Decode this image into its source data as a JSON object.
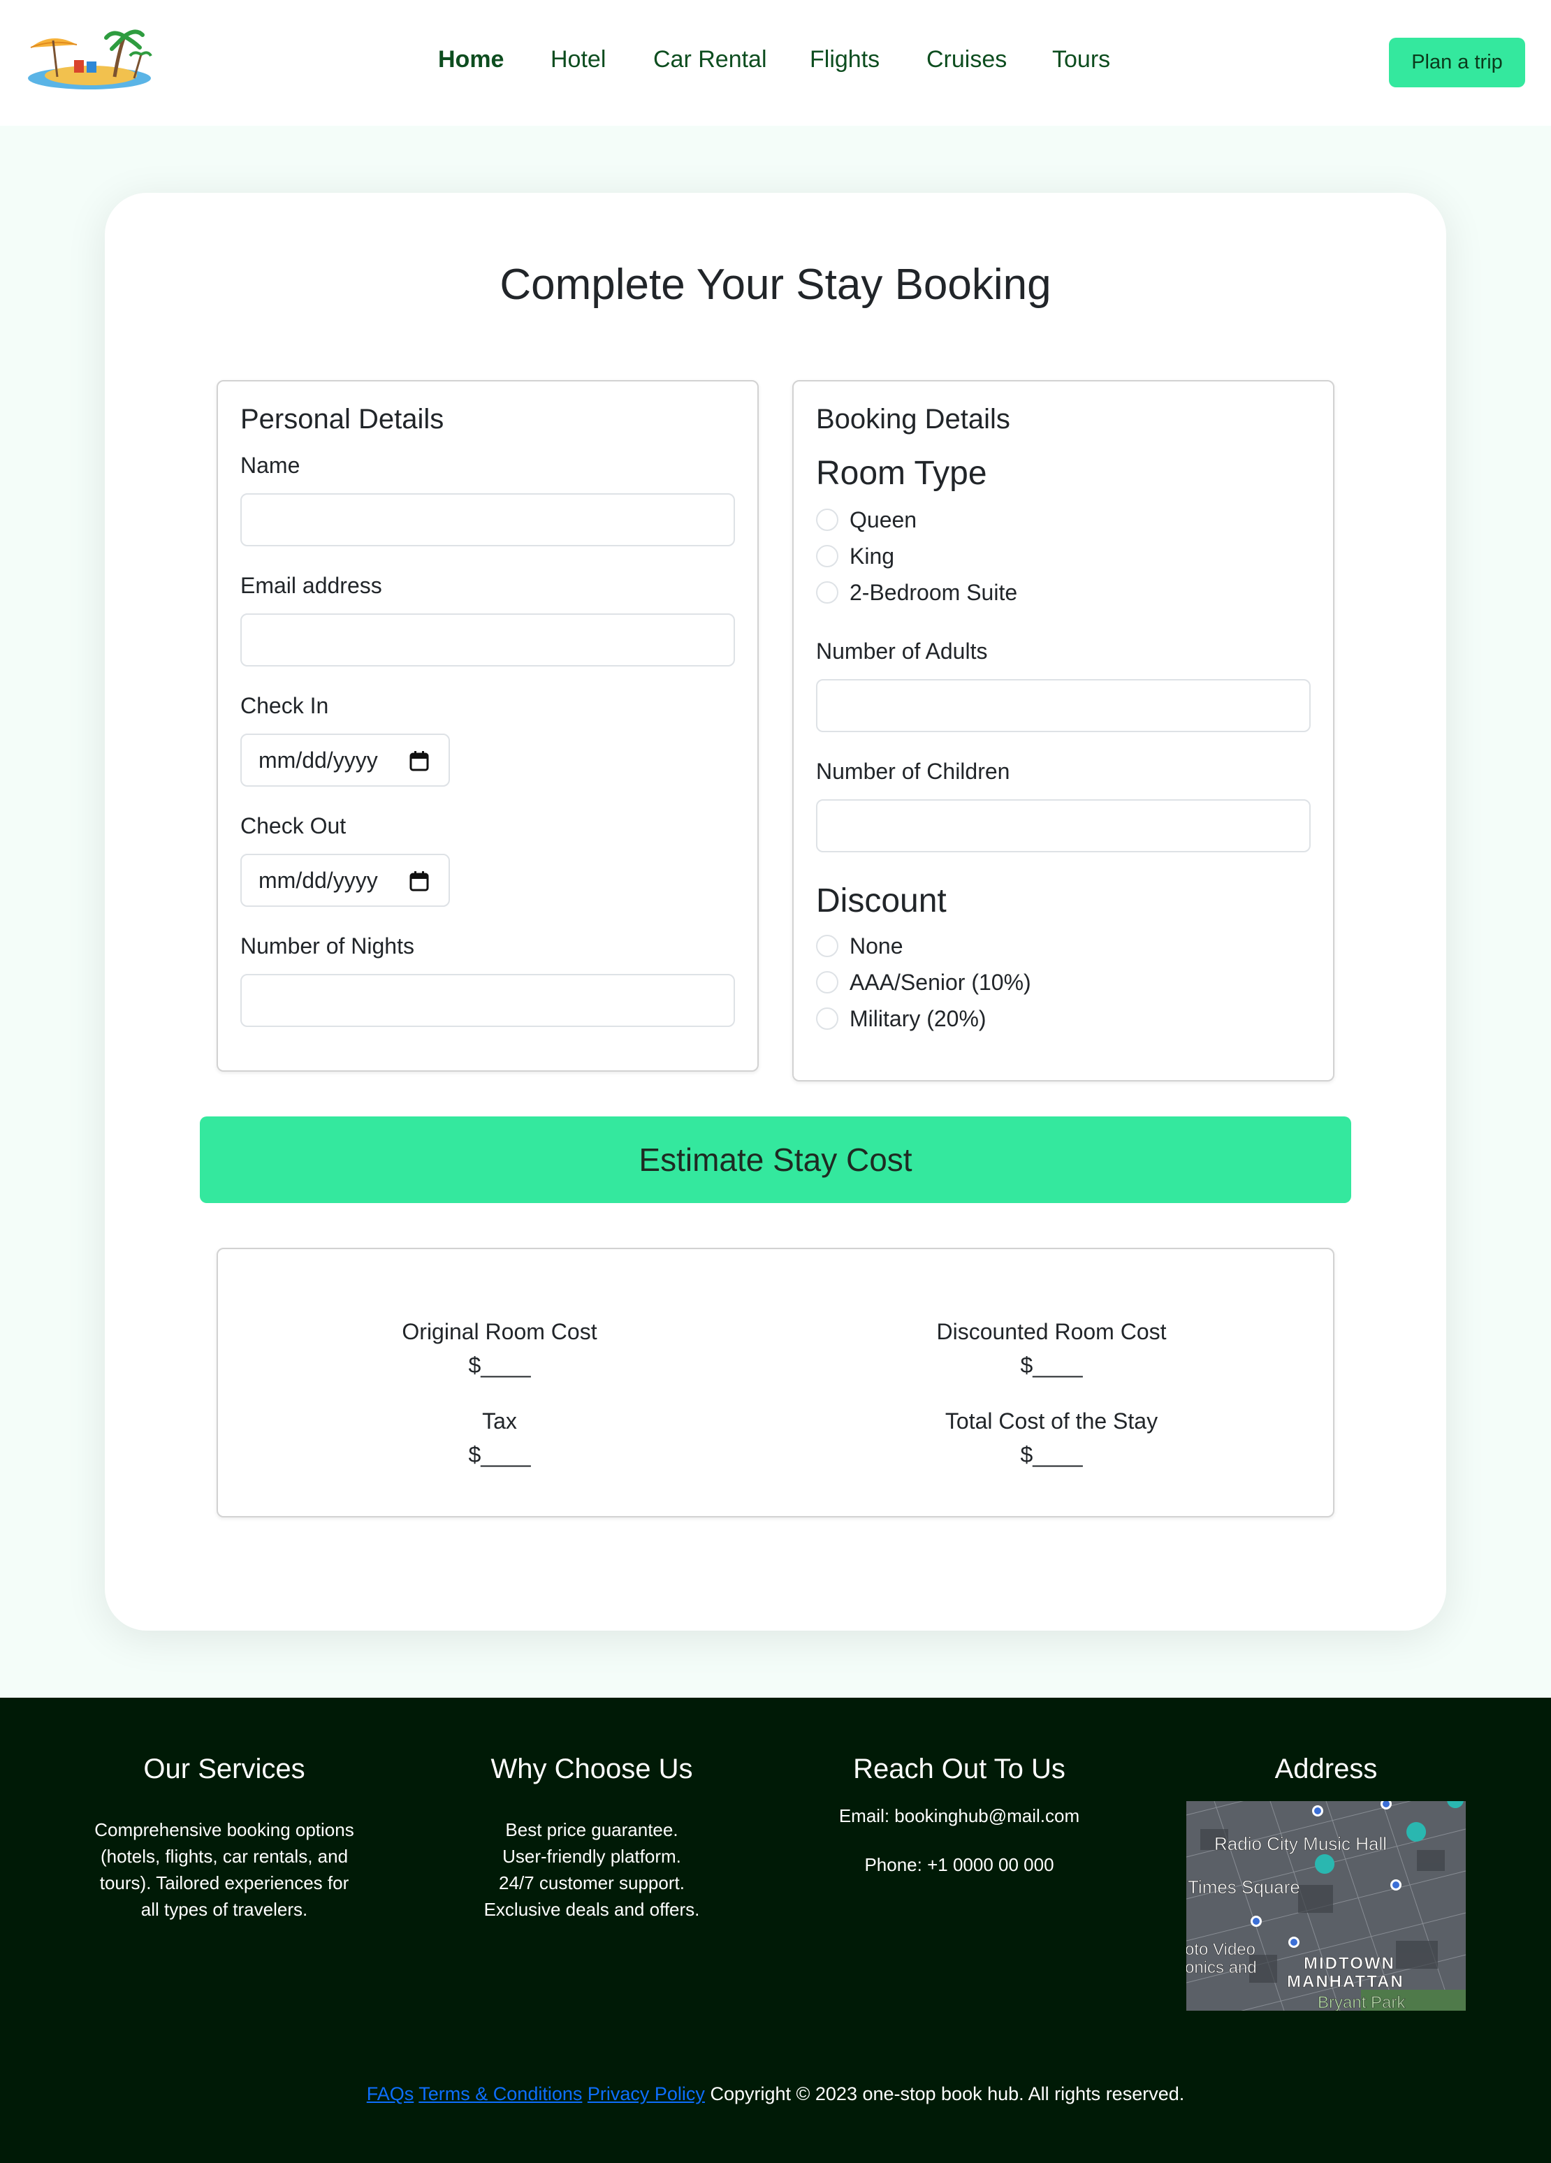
{
  "header": {
    "nav": [
      {
        "label": "Home",
        "active": true
      },
      {
        "label": "Hotel"
      },
      {
        "label": "Car Rental"
      },
      {
        "label": "Flights"
      },
      {
        "label": "Cruises"
      },
      {
        "label": "Tours"
      }
    ],
    "cta_label": "Plan a trip"
  },
  "main": {
    "title": "Complete Your Stay Booking",
    "personal": {
      "heading": "Personal Details",
      "name_label": "Name",
      "email_label": "Email address",
      "checkin_label": "Check In",
      "checkin_value": "mm/dd/yyyy",
      "checkout_label": "Check Out",
      "checkout_value": "mm/dd/yyyy",
      "nights_label": "Number of Nights"
    },
    "booking": {
      "heading": "Booking Details",
      "room_type_heading": "Room Type",
      "room_types": [
        "Queen",
        "King",
        "2-Bedroom Suite"
      ],
      "adults_label": "Number of Adults",
      "children_label": "Number of Children",
      "discount_heading": "Discount",
      "discounts": [
        "None",
        "AAA/Senior (10%)",
        "Military (20%)"
      ]
    },
    "estimate_label": "Estimate Stay Cost",
    "results": {
      "original_label": "Original Room Cost",
      "original_value": "$____",
      "discounted_label": "Discounted Room Cost",
      "discounted_value": "$____",
      "tax_label": "Tax",
      "tax_value": "$____",
      "total_label": "Total Cost of the Stay",
      "total_value": "$____"
    }
  },
  "footer": {
    "services_heading": "Our Services",
    "services_lines": [
      "Comprehensive booking options",
      "(hotels, flights, car rentals, and",
      "tours). Tailored experiences for",
      "all types of travelers."
    ],
    "why_heading": "Why Choose Us",
    "why_lines": [
      "Best price guarantee.",
      "User-friendly platform.",
      "24/7 customer support.",
      "Exclusive deals and offers."
    ],
    "reach_heading": "Reach Out To Us",
    "email_text": "Email: bookinghub@mail.com",
    "phone_text": "Phone: +1 0000 00 000",
    "address_heading": "Address",
    "map_labels": [
      "Radio City Music Hall",
      "Times Square",
      "oto Video",
      "onics and",
      "MIDTOWN",
      "MANHATTAN",
      "Bryant Park"
    ],
    "links": [
      "FAQs",
      "Terms & Conditions",
      "Privacy Policy"
    ],
    "copyright": "Copyright © 2023 one-stop book hub. All rights reserved."
  },
  "colors": {
    "accent": "#34e89e",
    "nav_text": "#0d4d1f",
    "footer_bg": "#001a06",
    "page_bg": "#f4fdf9",
    "link": "#0d6efd"
  }
}
